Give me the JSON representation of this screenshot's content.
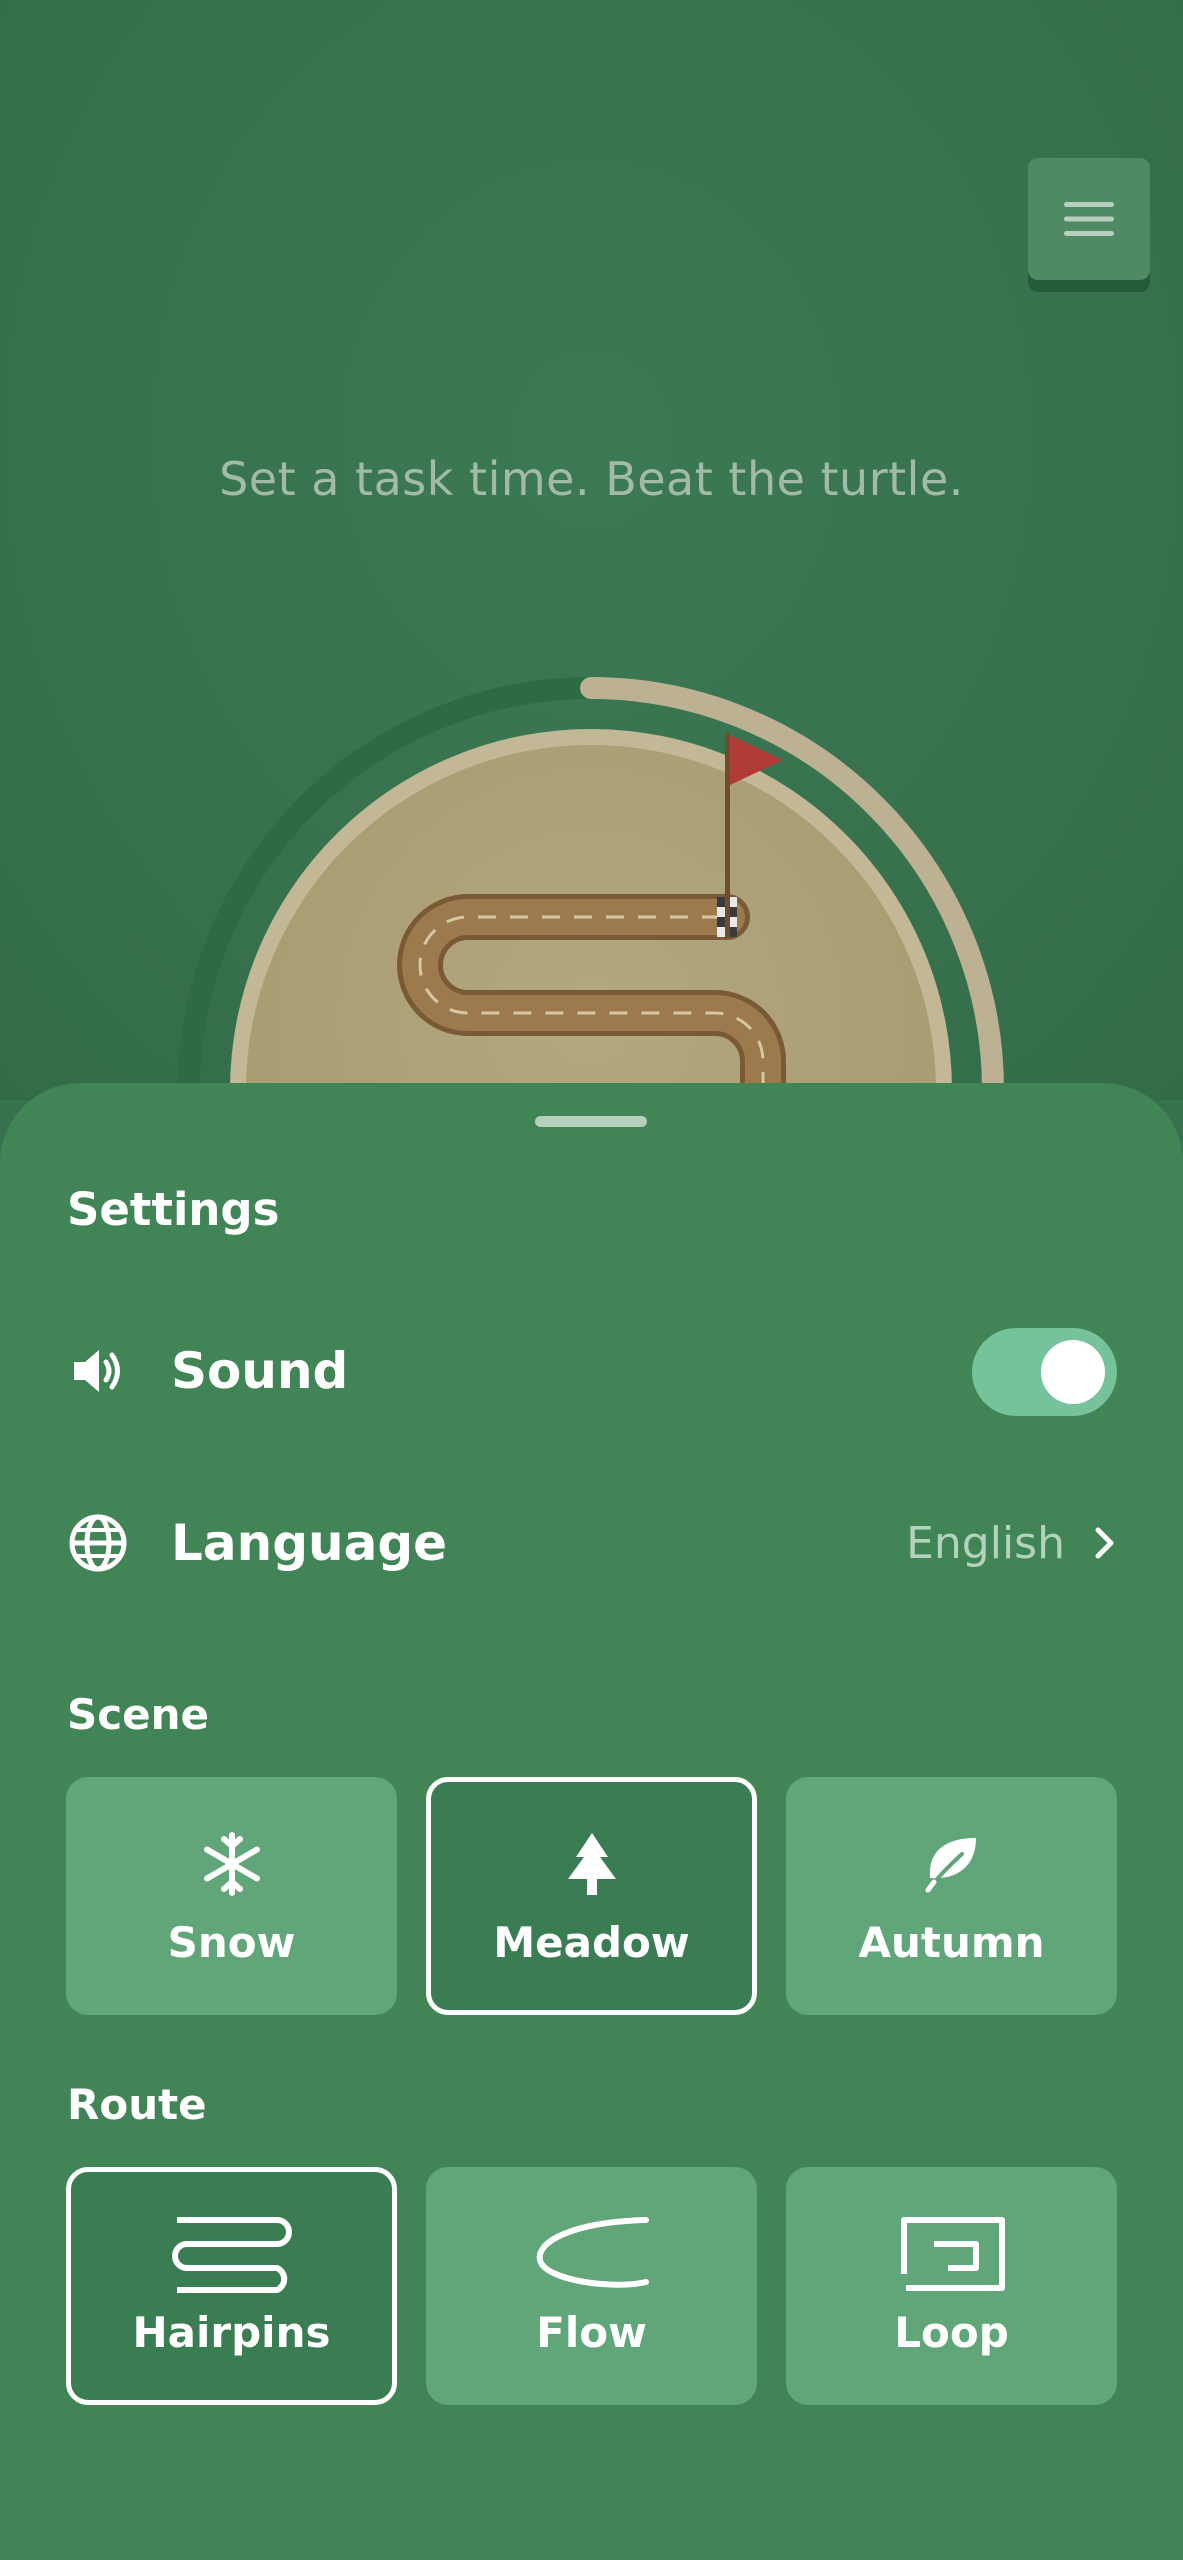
{
  "header": {
    "menu_icon": "hamburger-menu-icon",
    "tagline": "Set a task time. Beat the turtle."
  },
  "timer_dial": {
    "track_icon": "race-track-hairpins",
    "flag_icon": "finish-flag-icon",
    "progress_fraction": 0.25,
    "colors": {
      "ring": "#bcb193",
      "face": "#b5a97f",
      "track": "#8c6a3f",
      "flag": "#b03b37"
    }
  },
  "settings": {
    "title": "Settings",
    "sound": {
      "icon": "speaker-icon",
      "label": "Sound",
      "enabled": true
    },
    "language": {
      "icon": "globe-icon",
      "label": "Language",
      "value": "English",
      "chevron": "chevron-right-icon"
    },
    "scene": {
      "label": "Scene",
      "options": [
        {
          "icon": "snowflake-icon",
          "label": "Snow",
          "selected": false
        },
        {
          "icon": "tree-icon",
          "label": "Meadow",
          "selected": true
        },
        {
          "icon": "leaf-icon",
          "label": "Autumn",
          "selected": false
        }
      ]
    },
    "route": {
      "label": "Route",
      "options": [
        {
          "icon": "hairpins-route-icon",
          "label": "Hairpins",
          "selected": true
        },
        {
          "icon": "flow-route-icon",
          "label": "Flow",
          "selected": false
        },
        {
          "icon": "loop-route-icon",
          "label": "Loop",
          "selected": false
        }
      ]
    }
  },
  "colors": {
    "background": "#37724f",
    "sheet": "#418456",
    "card": "#61a679",
    "card_selected": "#3b7d53",
    "toggle_on": "#76c29a"
  }
}
